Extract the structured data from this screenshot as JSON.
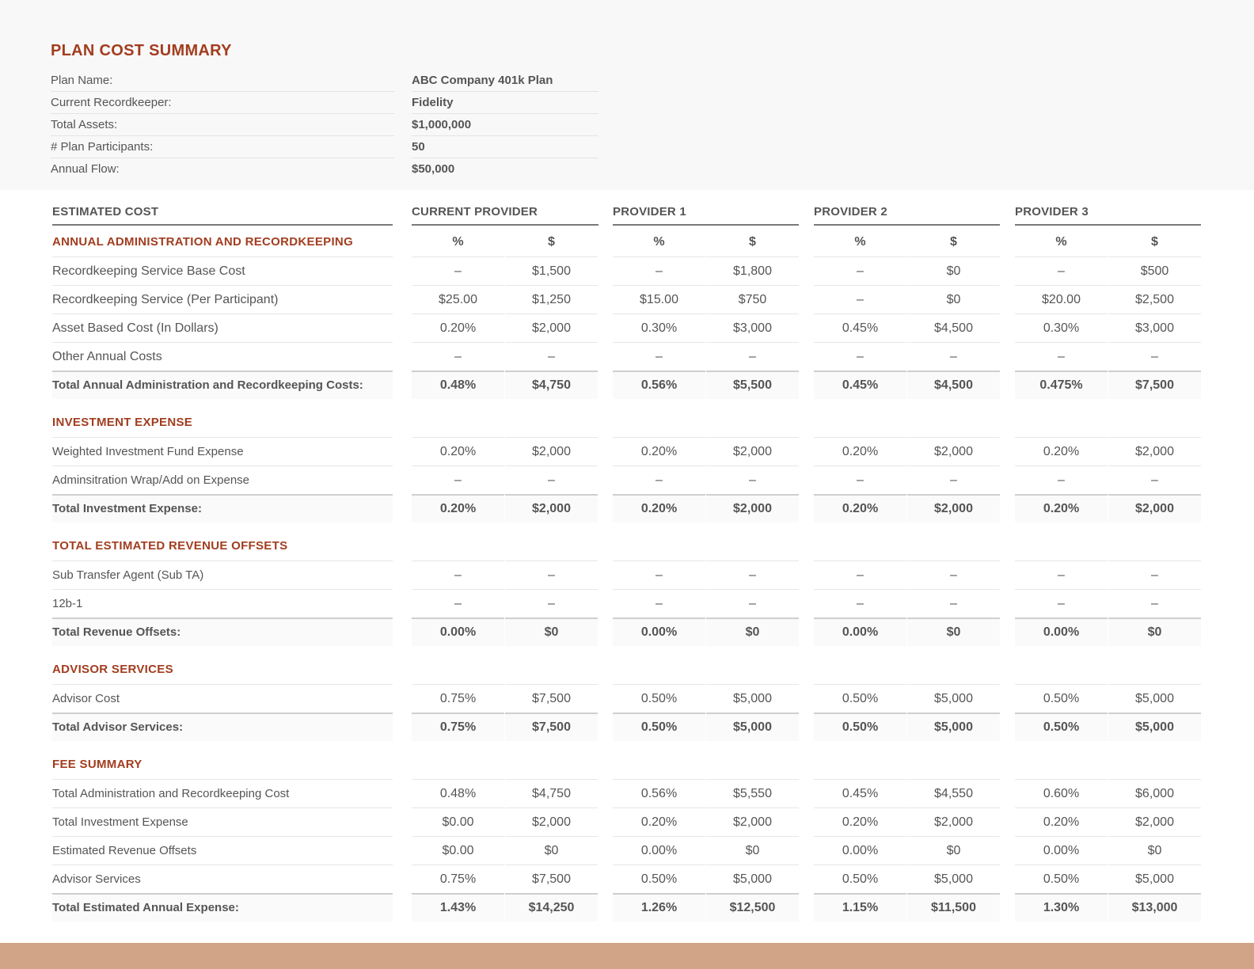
{
  "title": "PLAN COST SUMMARY",
  "plan_info": [
    {
      "label": "Plan Name:",
      "value": "ABC Company 401k Plan"
    },
    {
      "label": "Current Recordkeeper:",
      "value": "Fidelity"
    },
    {
      "label": "Total Assets:",
      "value": "$1,000,000"
    },
    {
      "label": "# Plan Participants:",
      "value": "50"
    },
    {
      "label": "Annual Flow:",
      "value": "$50,000"
    }
  ],
  "column_headers": {
    "estimated_cost": "ESTIMATED COST",
    "providers": [
      "CURRENT PROVIDER",
      "PROVIDER 1",
      "PROVIDER 2",
      "PROVIDER 3"
    ],
    "pct": "%",
    "usd": "$"
  },
  "sections": [
    {
      "title": "ANNUAL ADMINISTRATION AND RECORDKEEPING",
      "rows": [
        {
          "label": "Recordkeeping Service Base Cost",
          "values": [
            "–",
            "$1,500",
            "–",
            "$1,800",
            "–",
            "$0",
            "–",
            "$500"
          ]
        },
        {
          "label": "Recordkeeping Service (Per Participant)",
          "values": [
            "$25.00",
            "$1,250",
            "$15.00",
            "$750",
            "–",
            "$0",
            "$20.00",
            "$2,500"
          ]
        },
        {
          "label": "Asset Based Cost (In Dollars)",
          "values": [
            "0.20%",
            "$2,000",
            "0.30%",
            "$3,000",
            "0.45%",
            "$4,500",
            "0.30%",
            "$3,000"
          ]
        },
        {
          "label": "Other Annual Costs",
          "values": [
            "–",
            "–",
            "–",
            "–",
            "–",
            "–",
            "–",
            "–"
          ]
        }
      ],
      "total": {
        "label": "Total Annual Administration and Recordkeeping Costs:",
        "values": [
          "0.48%",
          "$4,750",
          "0.56%",
          "$5,500",
          "0.45%",
          "$4,500",
          "0.475%",
          "$7,500"
        ]
      }
    },
    {
      "title": "INVESTMENT EXPENSE",
      "rows": [
        {
          "label": "Weighted Investment Fund Expense",
          "values": [
            "0.20%",
            "$2,000",
            "0.20%",
            "$2,000",
            "0.20%",
            "$2,000",
            "0.20%",
            "$2,000"
          ]
        },
        {
          "label": "Adminsitration Wrap/Add on Expense",
          "values": [
            "–",
            "–",
            "–",
            "–",
            "–",
            "–",
            "–",
            "–"
          ]
        }
      ],
      "total": {
        "label": "Total Investment Expense:",
        "values": [
          "0.20%",
          "$2,000",
          "0.20%",
          "$2,000",
          "0.20%",
          "$2,000",
          "0.20%",
          "$2,000"
        ]
      }
    },
    {
      "title": "TOTAL ESTIMATED REVENUE OFFSETS",
      "rows": [
        {
          "label": "Sub Transfer Agent (Sub TA)",
          "values": [
            "–",
            "–",
            "–",
            "–",
            "–",
            "–",
            "–",
            "–"
          ]
        },
        {
          "label": "12b-1",
          "values": [
            "–",
            "–",
            "–",
            "–",
            "–",
            "–",
            "–",
            "–"
          ]
        }
      ],
      "total": {
        "label": "Total Revenue Offsets:",
        "values": [
          "0.00%",
          "$0",
          "0.00%",
          "$0",
          "0.00%",
          "$0",
          "0.00%",
          "$0"
        ]
      }
    },
    {
      "title": "ADVISOR SERVICES",
      "rows": [
        {
          "label": "Advisor Cost",
          "values": [
            "0.75%",
            "$7,500",
            "0.50%",
            "$5,000",
            "0.50%",
            "$5,000",
            "0.50%",
            "$5,000"
          ]
        }
      ],
      "total": {
        "label": "Total Advisor Services:",
        "values": [
          "0.75%",
          "$7,500",
          "0.50%",
          "$5,000",
          "0.50%",
          "$5,000",
          "0.50%",
          "$5,000"
        ]
      }
    },
    {
      "title": "FEE SUMMARY",
      "rows": [
        {
          "label": "Total Administration and Recordkeeping Cost",
          "values": [
            "0.48%",
            "$4,750",
            "0.56%",
            "$5,550",
            "0.45%",
            "$4,550",
            "0.60%",
            "$6,000"
          ]
        },
        {
          "label": "Total Investment Expense",
          "values": [
            "$0.00",
            "$2,000",
            "0.20%",
            "$2,000",
            "0.20%",
            "$2,000",
            "0.20%",
            "$2,000"
          ]
        },
        {
          "label": "Estimated Revenue Offsets",
          "values": [
            "$0.00",
            "$0",
            "0.00%",
            "$0",
            "0.00%",
            "$0",
            "0.00%",
            "$0"
          ]
        },
        {
          "label": "Advisor Services",
          "values": [
            "0.75%",
            "$7,500",
            "0.50%",
            "$5,000",
            "0.50%",
            "$5,000",
            "0.50%",
            "$5,000"
          ]
        }
      ],
      "total": {
        "label": "Total Estimated Annual Expense:",
        "values": [
          "1.43%",
          "$14,250",
          "1.26%",
          "$12,500",
          "1.15%",
          "$11,500",
          "1.30%",
          "$13,000"
        ]
      }
    }
  ]
}
